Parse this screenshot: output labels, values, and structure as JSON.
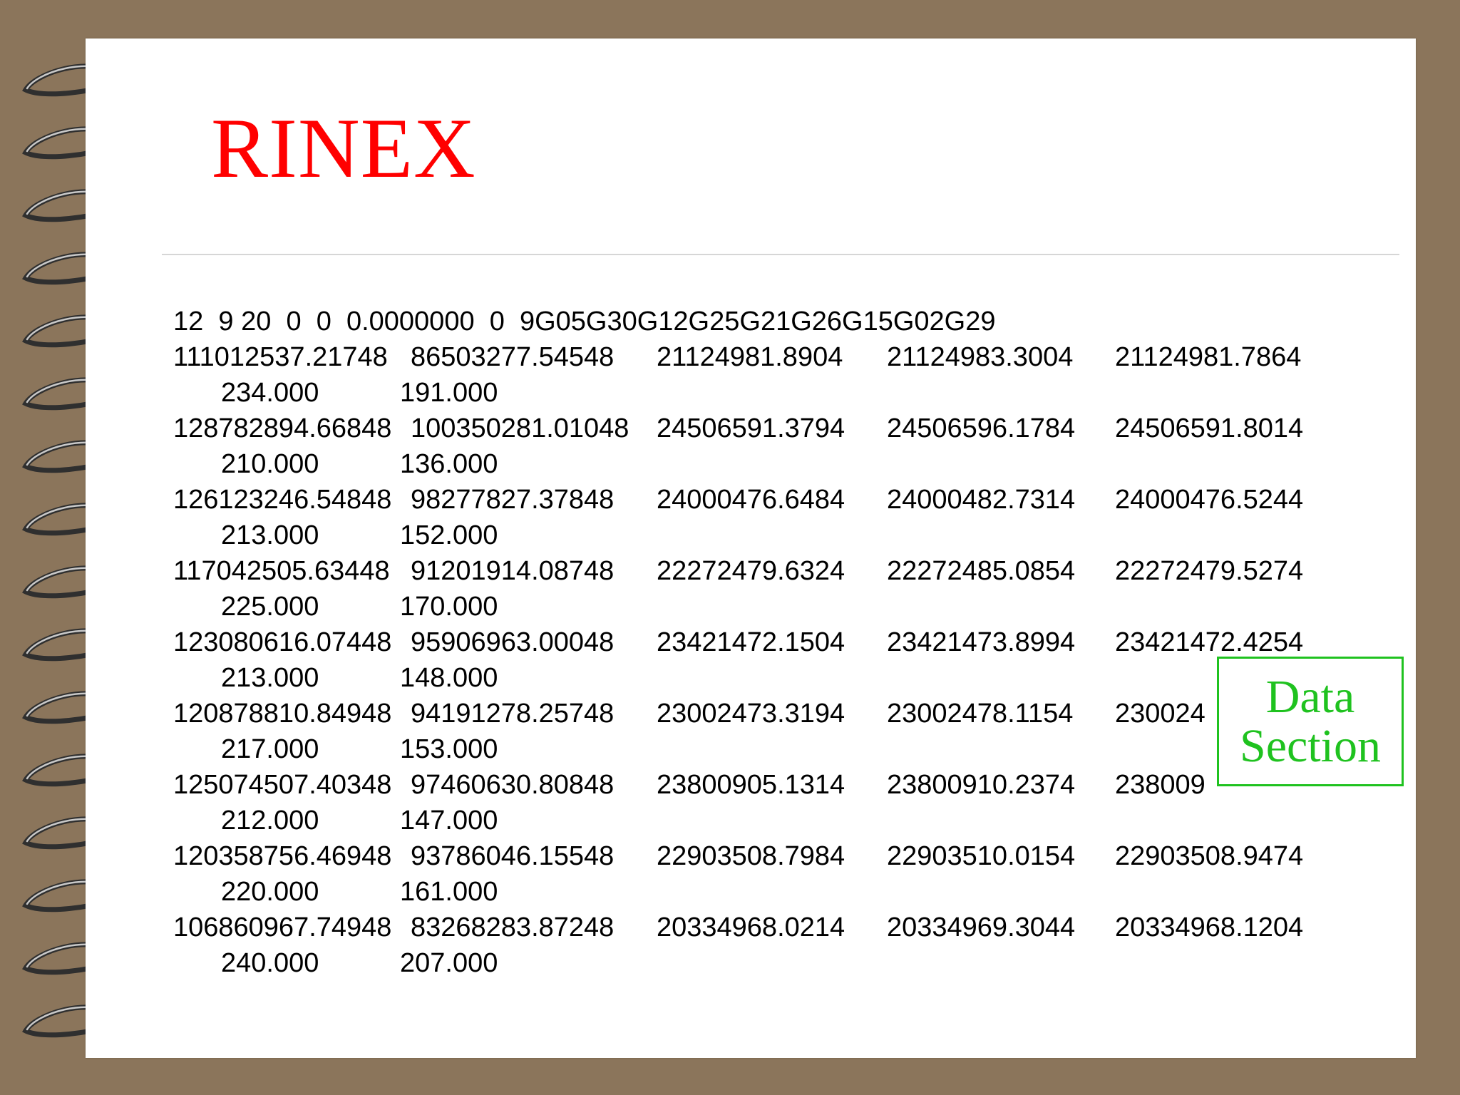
{
  "title": "RINEX",
  "epoch_line": "12  9 20  0  0  0.0000000  0  9G05G30G12G25G21G26G15G02G29",
  "observations": [
    {
      "v": [
        "111012537.21748",
        "86503277.54548",
        "21124981.8904",
        "21124983.3004",
        "21124981.7864"
      ],
      "s": [
        "234.000",
        "191.000"
      ]
    },
    {
      "v": [
        "128782894.66848",
        "100350281.01048",
        "24506591.3794",
        "24506596.1784",
        "24506591.8014"
      ],
      "s": [
        "210.000",
        "136.000"
      ]
    },
    {
      "v": [
        "126123246.54848",
        "98277827.37848",
        "24000476.6484",
        "24000482.7314",
        "24000476.5244"
      ],
      "s": [
        "213.000",
        "152.000"
      ]
    },
    {
      "v": [
        "117042505.63448",
        "91201914.08748",
        "22272479.6324",
        "22272485.0854",
        "22272479.5274"
      ],
      "s": [
        "225.000",
        "170.000"
      ]
    },
    {
      "v": [
        "123080616.07448",
        "95906963.00048",
        "23421472.1504",
        "23421473.8994",
        "23421472.4254"
      ],
      "s": [
        "213.000",
        "148.000"
      ]
    },
    {
      "v": [
        "120878810.84948",
        "94191278.25748",
        "23002473.3194",
        "23002478.1154",
        "230024"
      ],
      "s": [
        "217.000",
        "153.000"
      ]
    },
    {
      "v": [
        "125074507.40348",
        "97460630.80848",
        "23800905.1314",
        "23800910.2374",
        "238009"
      ],
      "s": [
        "212.000",
        "147.000"
      ]
    },
    {
      "v": [
        "120358756.46948",
        "93786046.15548",
        "22903508.7984",
        "22903510.0154",
        "22903508.9474"
      ],
      "s": [
        "220.000",
        "161.000"
      ]
    },
    {
      "v": [
        "106860967.74948",
        "83268283.87248",
        "20334968.0214",
        "20334969.3044",
        "20334968.1204"
      ],
      "s": [
        "240.000",
        "207.000"
      ]
    }
  ],
  "callout": {
    "line1": "Data",
    "line2": "Section"
  },
  "colors": {
    "title": "#ff0000",
    "callout": "#1fc21f",
    "background": "#8b755b"
  }
}
